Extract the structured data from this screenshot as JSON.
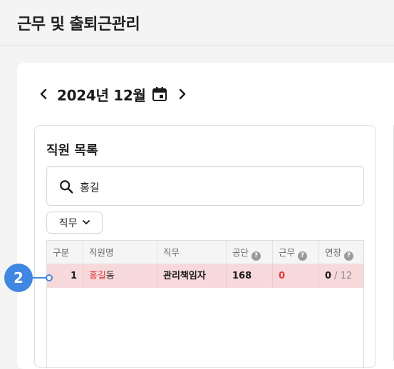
{
  "header": {
    "title": "근무 및 출퇴근관리"
  },
  "month_nav": {
    "label": "2024년 12월"
  },
  "employee_panel": {
    "title": "직원 목록",
    "search": {
      "value": "홍길",
      "placeholder": ""
    },
    "filter": {
      "label": "직무"
    },
    "table": {
      "columns": [
        "구분",
        "직원명",
        "직무",
        "공단",
        "근무",
        "연장"
      ],
      "help_glyph": "?",
      "rows": [
        {
          "index": "1",
          "name_highlight": "홍길",
          "name_rest": "동",
          "role": "관리책임자",
          "gongdan": "168",
          "work": "0",
          "overtime_value": "0",
          "overtime_sep": " / ",
          "overtime_total": "12"
        }
      ]
    }
  },
  "annotation": {
    "marker": "2"
  },
  "colors": {
    "accent": "#3f87e0",
    "row_highlight": "#f7d9dc",
    "red_text": "#e0393e"
  },
  "icons": [
    "chevron-left-icon",
    "chevron-right-icon",
    "calendar-icon",
    "search-icon",
    "chevron-down-icon",
    "help-icon"
  ]
}
